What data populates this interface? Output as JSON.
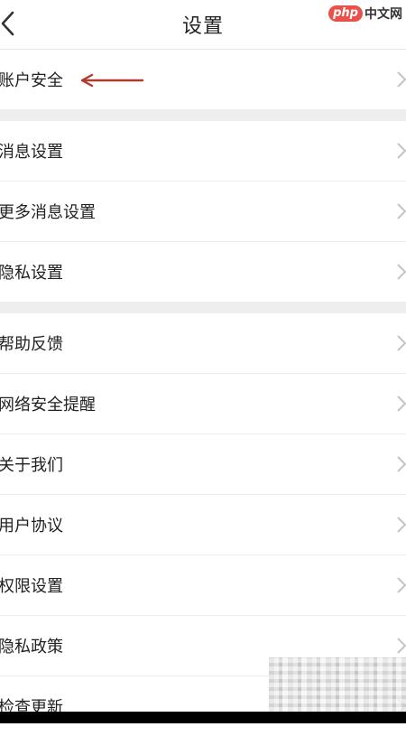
{
  "header": {
    "title": "设置",
    "back_icon": "chevron-left-icon"
  },
  "watermark": {
    "badge": "php",
    "text": "中文网"
  },
  "sections": [
    {
      "items": [
        {
          "label": "账户安全",
          "annotated": true
        }
      ]
    },
    {
      "items": [
        {
          "label": "消息设置"
        },
        {
          "label": "更多消息设置"
        },
        {
          "label": "隐私设置"
        }
      ]
    },
    {
      "items": [
        {
          "label": "帮助反馈"
        },
        {
          "label": "网络安全提醒"
        },
        {
          "label": "关于我们"
        },
        {
          "label": "用户协议"
        },
        {
          "label": "权限设置"
        },
        {
          "label": "隐私政策"
        },
        {
          "label": "检查更新"
        }
      ]
    }
  ],
  "colors": {
    "annotation_arrow": "#b03a2e",
    "section_gap": "#eeeeee",
    "chevron": "#c4c4c4"
  }
}
